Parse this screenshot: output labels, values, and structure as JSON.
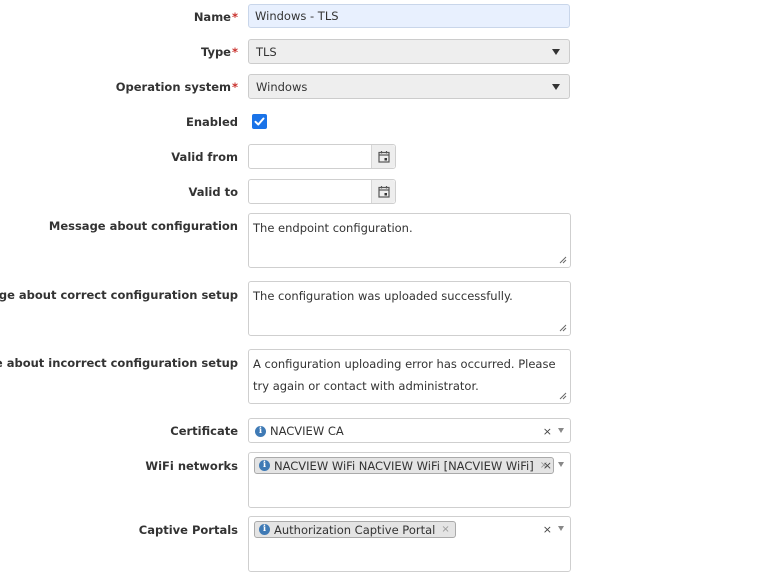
{
  "form": {
    "name": {
      "label": "Name",
      "required_mark": "*",
      "value": "Windows - TLS"
    },
    "type": {
      "label": "Type",
      "required_mark": "*",
      "selected": "TLS"
    },
    "os": {
      "label": "Operation system",
      "required_mark": "*",
      "selected": "Windows"
    },
    "enabled": {
      "label": "Enabled",
      "checked": true
    },
    "valid_from": {
      "label": "Valid from",
      "value": "",
      "icon": "calendar-icon"
    },
    "valid_to": {
      "label": "Valid to",
      "value": "",
      "icon": "calendar-icon"
    },
    "msg_config": {
      "label": "Message about configuration",
      "value": "The endpoint configuration."
    },
    "msg_correct": {
      "label": "Message about correct configuration setup",
      "value": "The configuration was uploaded successfully."
    },
    "msg_incorrect": {
      "label": "Message about incorrect configuration setup",
      "value": "A configuration uploading error has occurred. Please try again or contact with administrator."
    },
    "certificate": {
      "label": "Certificate",
      "selected": "NACVIEW CA",
      "icon": "info-icon",
      "clear": "×"
    },
    "wifi": {
      "label": "WiFi networks",
      "chips": [
        {
          "text": "NACVIEW WiFi NACVIEW WiFi [NACVIEW WiFi]",
          "remove": "×"
        }
      ],
      "clear": "×"
    },
    "captive": {
      "label": "Captive Portals",
      "chips": [
        {
          "text": "Authorization Captive Portal",
          "remove": "×"
        }
      ],
      "clear": "×"
    }
  },
  "colors": {
    "accent": "#1a73e8",
    "required": "#c9302c",
    "info_icon": "#3f7ab5",
    "autofill_bg": "#e8f0fe"
  }
}
